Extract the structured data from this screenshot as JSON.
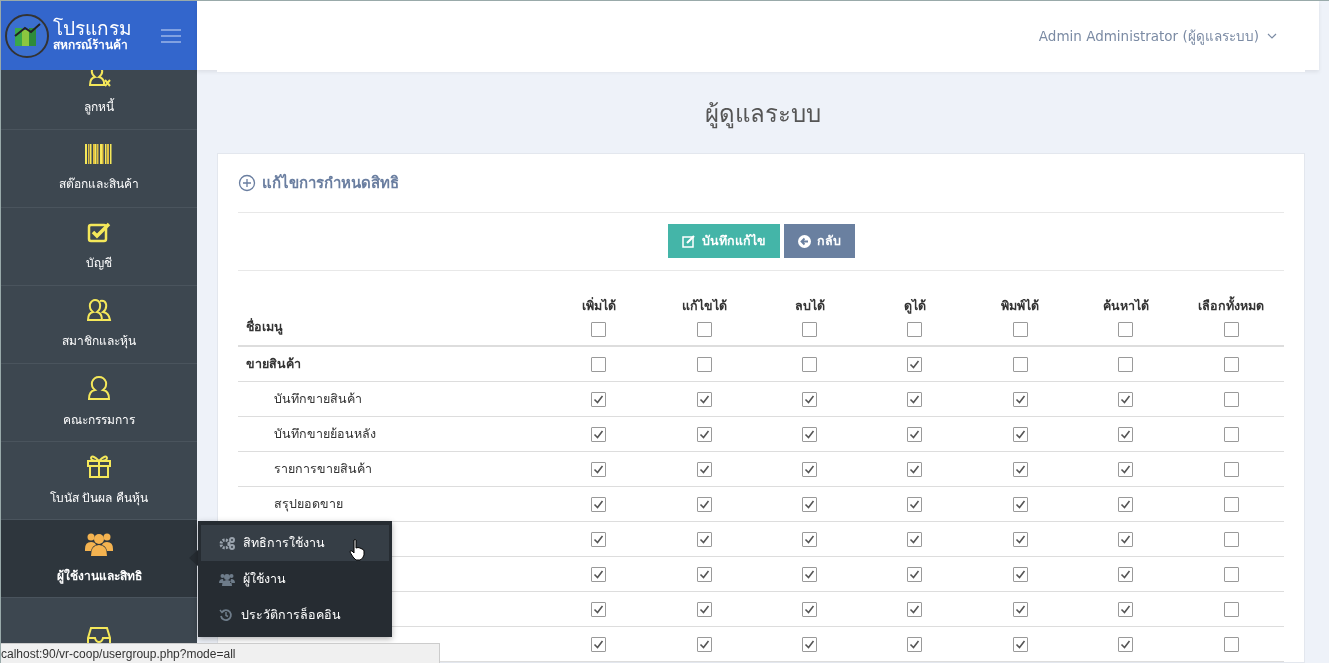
{
  "brand": {
    "title": "โปรแกรม",
    "subtitle": "สหกรณ์ร้านค้า"
  },
  "sidebar": {
    "items": [
      {
        "label": "ลูกหนี้",
        "selected": false
      },
      {
        "label": "สต๊อกและสินค้า",
        "selected": false
      },
      {
        "label": "บัญชี",
        "selected": false
      },
      {
        "label": "สมาชิกและหุ้น",
        "selected": false
      },
      {
        "label": "คณะกรรมการ",
        "selected": false
      },
      {
        "label": "โบนัส ปันผล คืนหุ้น",
        "selected": false
      },
      {
        "label": "ผู้ใช้งานและสิทธิ",
        "selected": true
      },
      {
        "selected": false
      }
    ]
  },
  "submenu": {
    "items": [
      {
        "label": "สิทธิการใช้งาน",
        "selected": true
      },
      {
        "label": "ผู้ใช้งาน",
        "selected": false
      },
      {
        "label": "ประวัติการล็อคอิน",
        "selected": false
      }
    ]
  },
  "user_menu": {
    "label": "Admin Administrator (ผู้ดูแลระบบ)"
  },
  "page_title": "ผู้ดูแลระบบ",
  "card": {
    "title": "แก้ไขการกำหนดสิทธิ",
    "buttons": [
      {
        "label": "บันทึกแก้ไข",
        "kind": "save"
      },
      {
        "label": "กลับ",
        "kind": "back"
      }
    ]
  },
  "table": {
    "name_column": "ชื่อเมนู",
    "columns": [
      {
        "label": "เพิ่มได้",
        "checked": false
      },
      {
        "label": "แก้ไขได้",
        "checked": false
      },
      {
        "label": "ลบได้",
        "checked": false
      },
      {
        "label": "ดูได้",
        "checked": false
      },
      {
        "label": "พิมพ์ได้",
        "checked": false
      },
      {
        "label": "ค้นหาได้",
        "checked": false
      },
      {
        "label": "เลือกทั้งหมด",
        "checked": false
      }
    ],
    "rows": [
      {
        "kind": "group",
        "label": "ขายสินค้า",
        "checks": [
          false,
          false,
          false,
          true,
          false,
          false,
          false
        ]
      },
      {
        "kind": "item",
        "label": "บันทึกขายสินค้า",
        "checks": [
          true,
          true,
          true,
          true,
          true,
          true,
          false
        ]
      },
      {
        "kind": "item",
        "label": "บันทึกขายย้อนหลัง",
        "checks": [
          true,
          true,
          true,
          true,
          true,
          true,
          false
        ]
      },
      {
        "kind": "item",
        "label": "รายการขายสินค้า",
        "checks": [
          true,
          true,
          true,
          true,
          true,
          true,
          false
        ]
      },
      {
        "kind": "item",
        "label": "สรุปยอดขาย",
        "checks": [
          true,
          true,
          true,
          true,
          true,
          true,
          false
        ]
      },
      {
        "kind": "item",
        "checks": [
          true,
          true,
          true,
          true,
          true,
          true,
          false
        ]
      },
      {
        "kind": "item",
        "checks": [
          true,
          true,
          true,
          true,
          true,
          true,
          false
        ]
      },
      {
        "kind": "item",
        "checks": [
          true,
          true,
          true,
          true,
          true,
          true,
          false
        ]
      },
      {
        "kind": "item",
        "checks": [
          true,
          true,
          true,
          true,
          true,
          true,
          false
        ]
      }
    ]
  },
  "status_bar": {
    "url": "calhost:90/vr-coop/usergroup.php?mode=all"
  }
}
